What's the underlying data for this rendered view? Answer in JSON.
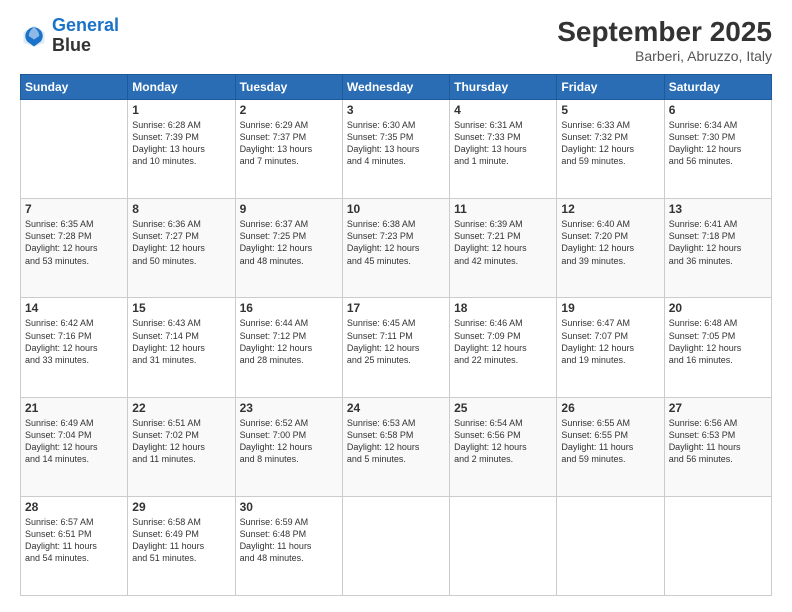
{
  "header": {
    "logo_line1": "General",
    "logo_line2": "Blue",
    "month": "September 2025",
    "location": "Barberi, Abruzzo, Italy"
  },
  "days_of_week": [
    "Sunday",
    "Monday",
    "Tuesday",
    "Wednesday",
    "Thursday",
    "Friday",
    "Saturday"
  ],
  "weeks": [
    [
      {
        "day": "",
        "text": ""
      },
      {
        "day": "1",
        "text": "Sunrise: 6:28 AM\nSunset: 7:39 PM\nDaylight: 13 hours\nand 10 minutes."
      },
      {
        "day": "2",
        "text": "Sunrise: 6:29 AM\nSunset: 7:37 PM\nDaylight: 13 hours\nand 7 minutes."
      },
      {
        "day": "3",
        "text": "Sunrise: 6:30 AM\nSunset: 7:35 PM\nDaylight: 13 hours\nand 4 minutes."
      },
      {
        "day": "4",
        "text": "Sunrise: 6:31 AM\nSunset: 7:33 PM\nDaylight: 13 hours\nand 1 minute."
      },
      {
        "day": "5",
        "text": "Sunrise: 6:33 AM\nSunset: 7:32 PM\nDaylight: 12 hours\nand 59 minutes."
      },
      {
        "day": "6",
        "text": "Sunrise: 6:34 AM\nSunset: 7:30 PM\nDaylight: 12 hours\nand 56 minutes."
      }
    ],
    [
      {
        "day": "7",
        "text": "Sunrise: 6:35 AM\nSunset: 7:28 PM\nDaylight: 12 hours\nand 53 minutes."
      },
      {
        "day": "8",
        "text": "Sunrise: 6:36 AM\nSunset: 7:27 PM\nDaylight: 12 hours\nand 50 minutes."
      },
      {
        "day": "9",
        "text": "Sunrise: 6:37 AM\nSunset: 7:25 PM\nDaylight: 12 hours\nand 48 minutes."
      },
      {
        "day": "10",
        "text": "Sunrise: 6:38 AM\nSunset: 7:23 PM\nDaylight: 12 hours\nand 45 minutes."
      },
      {
        "day": "11",
        "text": "Sunrise: 6:39 AM\nSunset: 7:21 PM\nDaylight: 12 hours\nand 42 minutes."
      },
      {
        "day": "12",
        "text": "Sunrise: 6:40 AM\nSunset: 7:20 PM\nDaylight: 12 hours\nand 39 minutes."
      },
      {
        "day": "13",
        "text": "Sunrise: 6:41 AM\nSunset: 7:18 PM\nDaylight: 12 hours\nand 36 minutes."
      }
    ],
    [
      {
        "day": "14",
        "text": "Sunrise: 6:42 AM\nSunset: 7:16 PM\nDaylight: 12 hours\nand 33 minutes."
      },
      {
        "day": "15",
        "text": "Sunrise: 6:43 AM\nSunset: 7:14 PM\nDaylight: 12 hours\nand 31 minutes."
      },
      {
        "day": "16",
        "text": "Sunrise: 6:44 AM\nSunset: 7:12 PM\nDaylight: 12 hours\nand 28 minutes."
      },
      {
        "day": "17",
        "text": "Sunrise: 6:45 AM\nSunset: 7:11 PM\nDaylight: 12 hours\nand 25 minutes."
      },
      {
        "day": "18",
        "text": "Sunrise: 6:46 AM\nSunset: 7:09 PM\nDaylight: 12 hours\nand 22 minutes."
      },
      {
        "day": "19",
        "text": "Sunrise: 6:47 AM\nSunset: 7:07 PM\nDaylight: 12 hours\nand 19 minutes."
      },
      {
        "day": "20",
        "text": "Sunrise: 6:48 AM\nSunset: 7:05 PM\nDaylight: 12 hours\nand 16 minutes."
      }
    ],
    [
      {
        "day": "21",
        "text": "Sunrise: 6:49 AM\nSunset: 7:04 PM\nDaylight: 12 hours\nand 14 minutes."
      },
      {
        "day": "22",
        "text": "Sunrise: 6:51 AM\nSunset: 7:02 PM\nDaylight: 12 hours\nand 11 minutes."
      },
      {
        "day": "23",
        "text": "Sunrise: 6:52 AM\nSunset: 7:00 PM\nDaylight: 12 hours\nand 8 minutes."
      },
      {
        "day": "24",
        "text": "Sunrise: 6:53 AM\nSunset: 6:58 PM\nDaylight: 12 hours\nand 5 minutes."
      },
      {
        "day": "25",
        "text": "Sunrise: 6:54 AM\nSunset: 6:56 PM\nDaylight: 12 hours\nand 2 minutes."
      },
      {
        "day": "26",
        "text": "Sunrise: 6:55 AM\nSunset: 6:55 PM\nDaylight: 11 hours\nand 59 minutes."
      },
      {
        "day": "27",
        "text": "Sunrise: 6:56 AM\nSunset: 6:53 PM\nDaylight: 11 hours\nand 56 minutes."
      }
    ],
    [
      {
        "day": "28",
        "text": "Sunrise: 6:57 AM\nSunset: 6:51 PM\nDaylight: 11 hours\nand 54 minutes."
      },
      {
        "day": "29",
        "text": "Sunrise: 6:58 AM\nSunset: 6:49 PM\nDaylight: 11 hours\nand 51 minutes."
      },
      {
        "day": "30",
        "text": "Sunrise: 6:59 AM\nSunset: 6:48 PM\nDaylight: 11 hours\nand 48 minutes."
      },
      {
        "day": "",
        "text": ""
      },
      {
        "day": "",
        "text": ""
      },
      {
        "day": "",
        "text": ""
      },
      {
        "day": "",
        "text": ""
      }
    ]
  ]
}
